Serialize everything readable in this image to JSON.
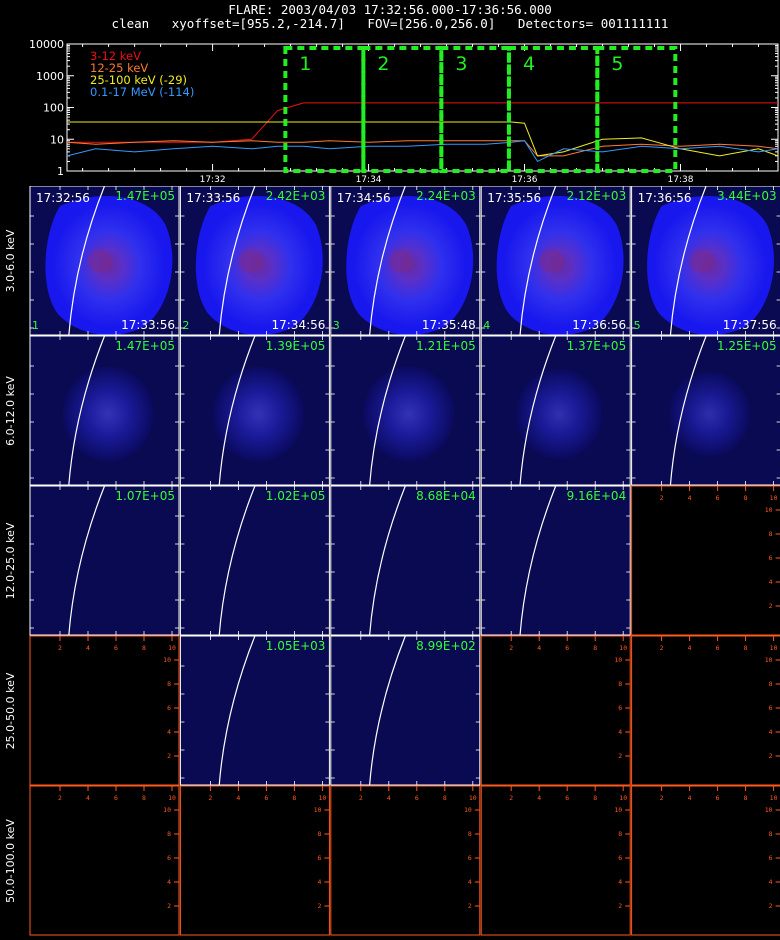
{
  "header": {
    "line1": "FLARE: 2003/04/03 17:32:56.000-17:36:56.000",
    "line2": "clean   xyoffset=[955.2,-214.7]   FOV=[256.0,256.0]   Detectors= 001111111"
  },
  "colors": {
    "box": "#22ee22",
    "axes": "#ffffff",
    "emptyAxes": "#ff5a1e",
    "annotation": "#33ff33",
    "limb": "#ffffff",
    "imageBg": "#0a0a52"
  },
  "chart_data": [
    {
      "type": "line",
      "ylog": true,
      "ylim": [
        1,
        10000
      ],
      "yticks": [
        {
          "v": 1,
          "label": "1"
        },
        {
          "v": 10,
          "label": "10"
        },
        {
          "v": 100,
          "label": "100"
        },
        {
          "v": 1000,
          "label": "1000"
        },
        {
          "v": 10000,
          "label": "10000"
        }
      ],
      "xlim": [
        "17:30:08",
        "17:39:15"
      ],
      "xticks": [
        {
          "t": "17:32:00",
          "label": "17:32"
        },
        {
          "t": "17:34:00",
          "label": "17:34"
        },
        {
          "t": "17:36:00",
          "label": "17:36"
        },
        {
          "t": "17:38:00",
          "label": "17:38"
        }
      ],
      "x": [
        "17:30:08",
        "17:30:30",
        "17:31:00",
        "17:31:30",
        "17:32:00",
        "17:32:30",
        "17:32:50",
        "17:33:10",
        "17:33:30",
        "17:34:00",
        "17:34:30",
        "17:35:00",
        "17:35:30",
        "17:35:50",
        "17:36:00",
        "17:36:10",
        "17:36:30",
        "17:37:00",
        "17:37:30",
        "17:38:00",
        "17:38:30",
        "17:39:00",
        "17:39:15"
      ],
      "series": [
        {
          "name": "3-12 keV",
          "color": "#ee1111",
          "values": [
            8,
            8,
            8,
            8,
            8,
            10,
            80,
            140,
            140,
            140,
            140,
            140,
            140,
            140,
            140,
            140,
            140,
            140,
            140,
            140,
            140,
            140,
            140
          ]
        },
        {
          "name": "12-25 keV",
          "color": "#ff7a33",
          "values": [
            8,
            7,
            8,
            9,
            8,
            9,
            8,
            8,
            9,
            8,
            9,
            9,
            9,
            9,
            9,
            3,
            3,
            6,
            7,
            6,
            7,
            6,
            5
          ]
        },
        {
          "name": "25-100 keV (-29)",
          "color": "#eeee22",
          "values": [
            35,
            35,
            35,
            35,
            35,
            35,
            35,
            35,
            35,
            35,
            35,
            35,
            35,
            35,
            32,
            3,
            4,
            10,
            11,
            5,
            3,
            5,
            3
          ]
        },
        {
          "name": "0.1-17 MeV (-114)",
          "color": "#3399ff",
          "values": [
            3,
            5,
            4,
            5,
            6,
            5,
            6,
            6,
            5,
            6,
            6,
            7,
            7,
            8,
            9,
            2,
            5,
            4,
            6,
            5,
            6,
            4,
            5
          ]
        }
      ],
      "intervals": [
        {
          "label": "1",
          "start": "17:32:56",
          "end": "17:33:56"
        },
        {
          "label": "2",
          "start": "17:33:56",
          "end": "17:34:56"
        },
        {
          "label": "3",
          "start": "17:34:56",
          "end": "17:35:48"
        },
        {
          "label": "4",
          "start": "17:35:48",
          "end": "17:36:56"
        },
        {
          "label": "5",
          "start": "17:36:56",
          "end": "17:37:56"
        }
      ]
    },
    {
      "type": "heatmap",
      "rows": [
        "3.0-6.0 keV",
        "6.0-12.0 keV",
        "12.0-25.0 keV",
        "25.0-50.0 keV",
        "50.0-100.0 keV"
      ],
      "emptyTicks": {
        "x": [
          "2",
          "4",
          "6",
          "8",
          "10"
        ],
        "y": [
          "2",
          "4",
          "6",
          "8",
          "10"
        ]
      },
      "panels": [
        [
          {
            "max": "1.47E+05",
            "start": "17:32:56",
            "end": "17:33:56",
            "index": "1",
            "level": 1.0
          },
          {
            "max": "2.42E+03",
            "start": "17:33:56",
            "end": "17:34:56",
            "index": "2",
            "level": 1.0
          },
          {
            "max": "2.24E+03",
            "start": "17:34:56",
            "end": "17:35:48",
            "index": "3",
            "level": 1.0
          },
          {
            "max": "2.12E+03",
            "start": "17:35:56",
            "end": "17:36:56",
            "index": "4",
            "level": 1.0
          },
          {
            "max": "3.44E+03",
            "start": "17:36:56",
            "end": "17:37:56",
            "index": "5",
            "level": 1.0
          }
        ],
        [
          {
            "max": "1.47E+05",
            "level": 0.35
          },
          {
            "max": "1.39E+05",
            "level": 0.35
          },
          {
            "max": "1.21E+05",
            "level": 0.35
          },
          {
            "max": "1.37E+05",
            "level": 0.3
          },
          {
            "max": "1.25E+05",
            "level": 0.25
          }
        ],
        [
          {
            "max": "1.07E+05",
            "level": 0
          },
          {
            "max": "1.02E+05",
            "level": 0
          },
          {
            "max": "8.68E+04",
            "level": 0
          },
          {
            "max": "9.16E+04",
            "level": 0
          },
          {
            "empty": true
          }
        ],
        [
          {
            "empty": true
          },
          {
            "max": "1.05E+03",
            "level": 0
          },
          {
            "max": "8.99E+02",
            "level": 0
          },
          {
            "empty": true
          },
          {
            "empty": true
          }
        ],
        [
          {
            "empty": true
          },
          {
            "empty": true
          },
          {
            "empty": true
          },
          {
            "empty": true
          },
          {
            "empty": true
          }
        ]
      ]
    }
  ]
}
